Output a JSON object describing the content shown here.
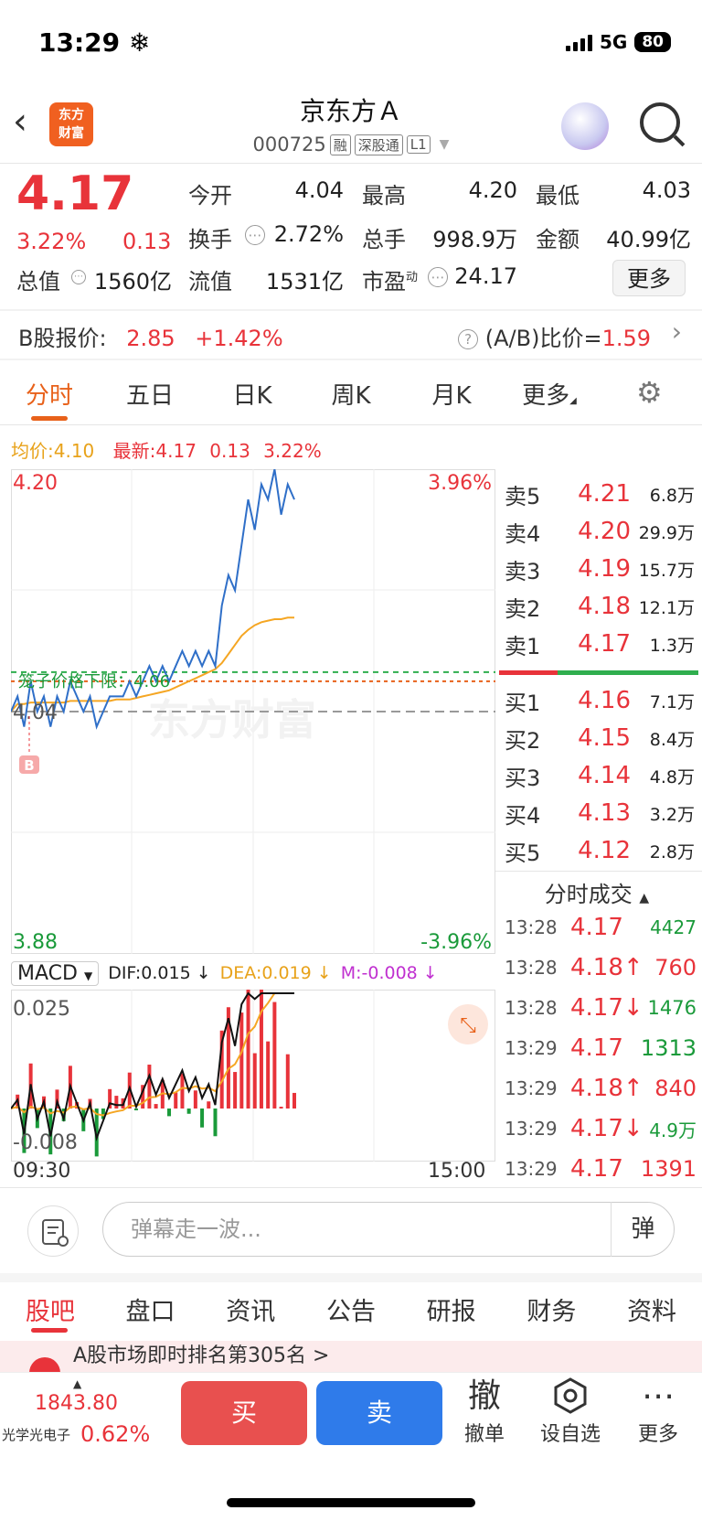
{
  "status": {
    "time": "13:29",
    "network": "5G",
    "battery": "80"
  },
  "header": {
    "logo_line1": "东方",
    "logo_line2": "财富",
    "title": "京东方Ａ",
    "code": "000725",
    "tags": [
      "融",
      "深股通",
      "L1"
    ]
  },
  "quote": {
    "price": "4.17",
    "change_pct": "3.22%",
    "change_abs": "0.13",
    "open_label": "今开",
    "open": "4.04",
    "high_label": "最高",
    "high": "4.20",
    "low_label": "最低",
    "low": "4.03",
    "turnover_label": "换手",
    "turnover": "2.72%",
    "volume_label": "总手",
    "volume": "998.9万",
    "amount_label": "金额",
    "amount": "40.99亿",
    "mktcap_label": "总值",
    "mktcap": "1560亿",
    "float_label": "流值",
    "float_cap": "1531亿",
    "pe_label": "市盈",
    "pe_sup": "动",
    "pe": "24.17",
    "more": "更多"
  },
  "bshare": {
    "label": "B股报价:",
    "price": "2.85",
    "pct": "+1.42%",
    "ratio_label": "(A/B)比价=",
    "ratio": "1.59"
  },
  "tabs": [
    "分时",
    "五日",
    "日K",
    "周K",
    "月K",
    "更多"
  ],
  "legend": {
    "avg_label": "均价:",
    "avg": "4.10",
    "latest_label": "最新:",
    "latest": "4.17",
    "chg": "0.13",
    "pct": "3.22%"
  },
  "chart_labels": {
    "top_price": "4.20",
    "top_pct": "3.96%",
    "mid_price": "4.04",
    "bottom_price": "3.88",
    "bottom_pct": "-3.96%",
    "limit_label": "笼子价格下限：4.06",
    "marker_b": "B",
    "watermark": "东方财富",
    "time_start": "09:30",
    "time_end": "15:00"
  },
  "macd": {
    "name": "MACD",
    "dif": "DIF:0.015 ↓",
    "dea": "DEA:0.019 ↓",
    "m": "M:-0.008 ↓",
    "top": "0.025",
    "bottom": "-0.008"
  },
  "chart_data": {
    "type": "line",
    "title": "",
    "x_range": [
      "09:30",
      "15:00"
    ],
    "ylim": [
      3.88,
      4.2
    ],
    "prev_close": 4.04,
    "series": [
      {
        "name": "最新",
        "values": [
          4.04,
          4.05,
          4.03,
          4.06,
          4.04,
          4.05,
          4.03,
          4.05,
          4.04,
          4.06,
          4.05,
          4.04,
          4.05,
          4.03,
          4.04,
          4.05,
          4.05,
          4.05,
          4.06,
          4.05,
          4.06,
          4.07,
          4.06,
          4.07,
          4.06,
          4.07,
          4.08,
          4.07,
          4.08,
          4.07,
          4.08,
          4.07,
          4.11,
          4.13,
          4.12,
          4.15,
          4.18,
          4.16,
          4.19,
          4.18,
          4.2,
          4.17,
          4.19,
          4.18
        ]
      },
      {
        "name": "均价",
        "values": [
          4.04,
          4.045,
          4.045,
          4.046,
          4.046,
          4.046,
          4.046,
          4.046,
          4.046,
          4.047,
          4.047,
          4.047,
          4.047,
          4.047,
          4.047,
          4.047,
          4.048,
          4.048,
          4.048,
          4.049,
          4.05,
          4.051,
          4.052,
          4.053,
          4.054,
          4.056,
          4.058,
          4.06,
          4.062,
          4.064,
          4.066,
          4.068,
          4.072,
          4.078,
          4.084,
          4.09,
          4.094,
          4.097,
          4.099,
          4.1,
          4.101,
          4.101,
          4.102,
          4.102
        ]
      }
    ]
  },
  "order_book": {
    "asks": [
      {
        "label": "卖5",
        "price": "4.21",
        "vol": "6.8万"
      },
      {
        "label": "卖4",
        "price": "4.20",
        "vol": "29.9万"
      },
      {
        "label": "卖3",
        "price": "4.19",
        "vol": "15.7万"
      },
      {
        "label": "卖2",
        "price": "4.18",
        "vol": "12.1万"
      },
      {
        "label": "卖1",
        "price": "4.17",
        "vol": "1.3万"
      }
    ],
    "bids": [
      {
        "label": "买1",
        "price": "4.16",
        "vol": "7.1万"
      },
      {
        "label": "买2",
        "price": "4.15",
        "vol": "8.4万"
      },
      {
        "label": "买3",
        "price": "4.14",
        "vol": "4.8万"
      },
      {
        "label": "买4",
        "price": "4.13",
        "vol": "3.2万"
      },
      {
        "label": "买5",
        "price": "4.12",
        "vol": "2.8万"
      }
    ]
  },
  "trades": {
    "title": "分时成交",
    "rows": [
      {
        "time": "13:28",
        "price": "4.17",
        "vol": "4427"
      },
      {
        "time": "13:28",
        "price": "4.18↑",
        "vol": "760"
      },
      {
        "time": "13:28",
        "price": "4.17↓",
        "vol": "1476"
      },
      {
        "time": "13:29",
        "price": "4.17",
        "vol": "1313"
      },
      {
        "time": "13:29",
        "price": "4.18↑",
        "vol": "840"
      },
      {
        "time": "13:29",
        "price": "4.17↓",
        "vol": "4.9万"
      },
      {
        "time": "13:29",
        "price": "4.17",
        "vol": "1391"
      }
    ]
  },
  "danmaku": {
    "placeholder": "弹幕走一波...",
    "button": "弹"
  },
  "bottom_tabs": [
    "股吧",
    "盘口",
    "资讯",
    "公告",
    "研报",
    "财务",
    "资料"
  ],
  "news": {
    "text": "A股市场即时排名第305名 >"
  },
  "footer": {
    "index_val": "1843.80",
    "index_name": "光学光电子",
    "index_pct": "0.62%",
    "buy": "买",
    "sell": "卖",
    "cancel_icon": "撤",
    "cancel": "撤单",
    "watch": "设自选",
    "more": "更多"
  },
  "colors": {
    "up": "#e8333a",
    "down": "#1a9a3a",
    "accent": "#e8611a",
    "price_line": "#2f6fc8",
    "avg_line": "#f5a623"
  }
}
